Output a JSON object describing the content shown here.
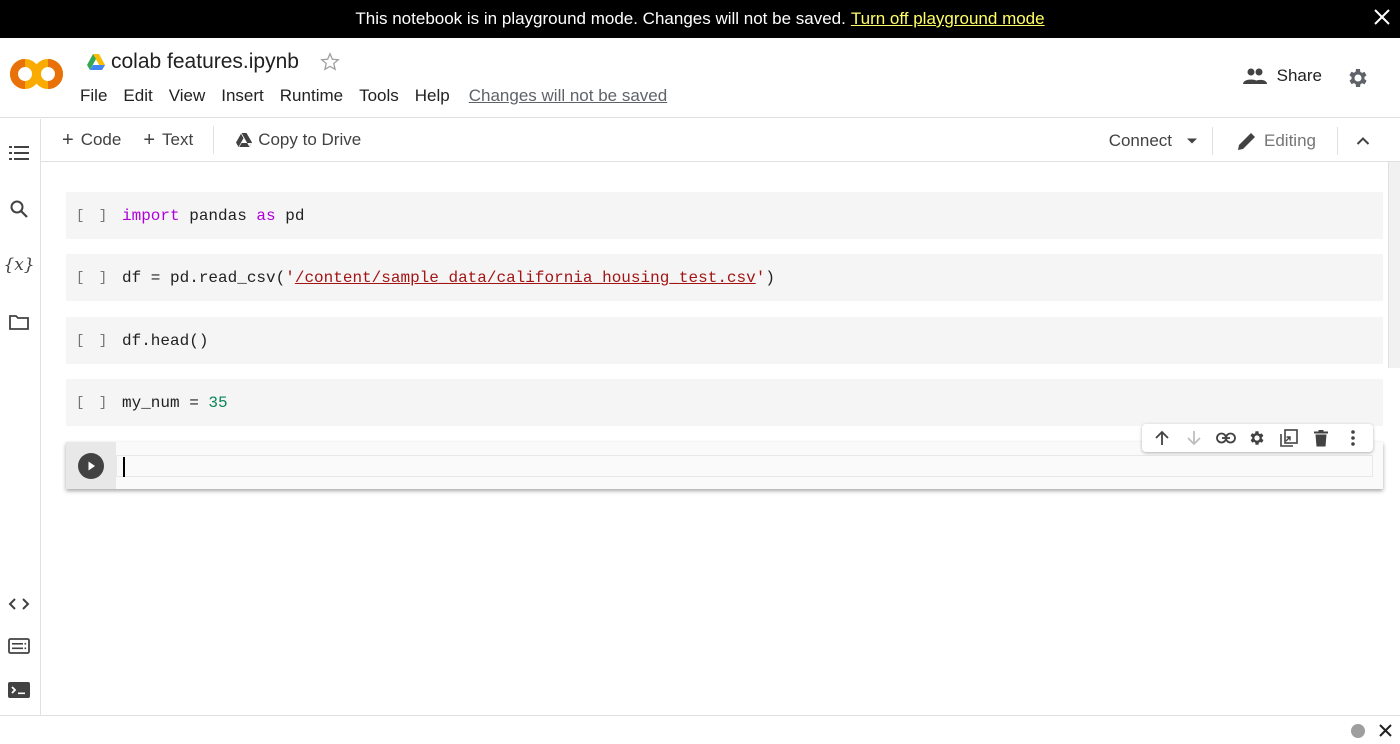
{
  "banner": {
    "message": "This notebook is in playground mode. Changes will not be saved.",
    "link_label": "Turn off playground mode",
    "link_color": "#ffff66"
  },
  "header": {
    "notebook_title": "colab features.ipynb",
    "menu": [
      "File",
      "Edit",
      "View",
      "Insert",
      "Runtime",
      "Tools",
      "Help"
    ],
    "unsaved_notice": "Changes will not be saved",
    "share_label": "Share",
    "logo_colors": [
      "#f9ab00",
      "#e8710a"
    ]
  },
  "toolbar": {
    "add_code_label": "Code",
    "add_text_label": "Text",
    "copy_to_drive_label": "Copy to Drive",
    "connect_label": "Connect",
    "editing_label": "Editing"
  },
  "sidebar": {
    "top_icons": [
      "table-of-contents-icon",
      "search-icon",
      "variables-icon",
      "files-icon"
    ],
    "bottom_icons": [
      "code-snippets-icon",
      "command-palette-icon",
      "terminal-icon"
    ]
  },
  "cells": [
    {
      "exec": "[ ]",
      "tokens": [
        {
          "t": "import",
          "c": "kw"
        },
        {
          "t": " pandas ",
          "c": ""
        },
        {
          "t": "as",
          "c": "kw"
        },
        {
          "t": " pd",
          "c": ""
        }
      ]
    },
    {
      "exec": "[ ]",
      "tokens": [
        {
          "t": "df = pd.read_csv(",
          "c": ""
        },
        {
          "t": "'",
          "c": "q"
        },
        {
          "t": "/content/sample_data/california_housing_test.csv",
          "c": "str"
        },
        {
          "t": "'",
          "c": "q"
        },
        {
          "t": ")",
          "c": ""
        }
      ]
    },
    {
      "exec": "[ ]",
      "tokens": [
        {
          "t": "df.head()",
          "c": ""
        }
      ]
    },
    {
      "exec": "[ ]",
      "tokens": [
        {
          "t": "my_num = ",
          "c": ""
        },
        {
          "t": "35",
          "c": "num"
        }
      ]
    }
  ],
  "active_cell": {
    "content": ""
  },
  "cell_toolbar": [
    "move-up-icon",
    "move-down-icon",
    "link-icon",
    "cell-settings-icon",
    "mirror-cell-icon",
    "delete-icon",
    "more-vert-icon"
  ],
  "colors": {
    "keyword": "#af00db",
    "string": "#a31515",
    "number": "#098658"
  }
}
